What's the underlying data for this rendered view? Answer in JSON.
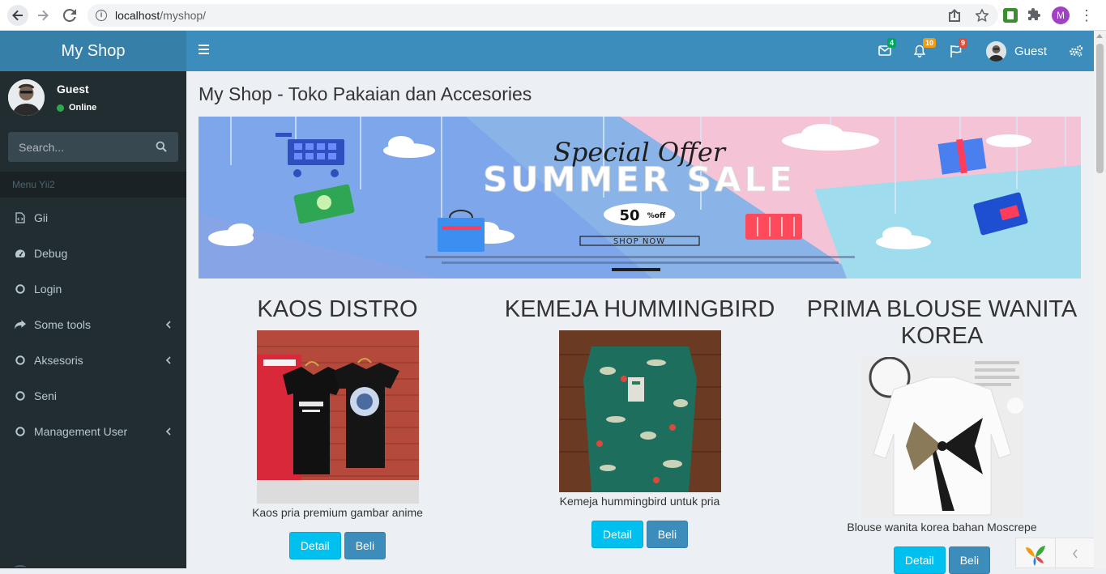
{
  "browser": {
    "url_host": "localhost",
    "url_path": "/myshop/",
    "profile_initial": "M"
  },
  "header": {
    "brand": "My Shop",
    "messages_count": "4",
    "notifications_count": "10",
    "tasks_count": "9",
    "user_name": "Guest"
  },
  "sidebar": {
    "user_name": "Guest",
    "user_status": "Online",
    "search_placeholder": "Search...",
    "menu_header": "Menu Yii2",
    "items": [
      {
        "label": "Gii",
        "icon": "file-code-icon",
        "has_children": false
      },
      {
        "label": "Debug",
        "icon": "dashboard-icon",
        "has_children": false
      },
      {
        "label": "Login",
        "icon": "circle-icon",
        "has_children": false
      },
      {
        "label": "Some tools",
        "icon": "share-icon",
        "has_children": true
      },
      {
        "label": "Aksesoris",
        "icon": "circle-icon",
        "has_children": true
      },
      {
        "label": "Seni",
        "icon": "circle-icon",
        "has_children": false
      },
      {
        "label": "Management User",
        "icon": "circle-icon",
        "has_children": true
      }
    ]
  },
  "main": {
    "title": "My Shop - Toko Pakaian dan Accesories",
    "banner": {
      "line1": "Special Offer",
      "line2": "SUMMER SALE",
      "discount": "50",
      "discount_suffix": "%off",
      "cta": "SHOP NOW"
    },
    "products": [
      {
        "name": "KAOS DISTRO",
        "description": "Kaos pria premium gambar anime",
        "detail_label": "Detail",
        "buy_label": "Beli"
      },
      {
        "name": "KEMEJA HUMMINGBIRD",
        "description": "Kemeja hummingbird untuk pria",
        "detail_label": "Detail",
        "buy_label": "Beli"
      },
      {
        "name": "PRIMA BLOUSE WANITA KOREA",
        "description": "Blouse wanita korea bahan Moscrepe",
        "detail_label": "Detail",
        "buy_label": "Beli"
      }
    ]
  },
  "colors": {
    "logo_bg": "#367fa9",
    "navbar_bg": "#3c8dbc",
    "sidebar_bg": "#222d32",
    "content_bg": "#ecf0f5",
    "btn_info": "#00c0ef",
    "btn_primary": "#3c8dbc",
    "badge_green": "#00a65a",
    "badge_yellow": "#f39c12",
    "badge_red": "#dd4b39"
  }
}
